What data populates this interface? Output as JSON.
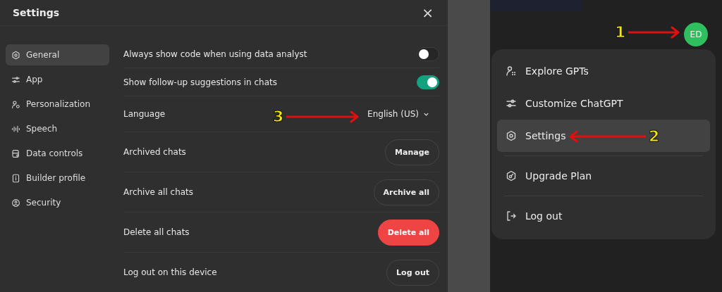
{
  "settings_dialog": {
    "title": "Settings",
    "close": "×",
    "sidebar": {
      "items": [
        {
          "label": "General",
          "selected": true
        },
        {
          "label": "App",
          "selected": false
        },
        {
          "label": "Personalization",
          "selected": false
        },
        {
          "label": "Speech",
          "selected": false
        },
        {
          "label": "Data controls",
          "selected": false
        },
        {
          "label": "Builder profile",
          "selected": false
        },
        {
          "label": "Security",
          "selected": false
        }
      ]
    },
    "rows": [
      {
        "kind": "toggle",
        "label": "Always show code when using data analyst",
        "on": false
      },
      {
        "kind": "toggle",
        "label": "Show follow-up suggestions in chats",
        "on": true
      },
      {
        "kind": "select",
        "label": "Language",
        "value": "English (US)"
      },
      {
        "kind": "button",
        "label": "Archived chats",
        "button": "Manage"
      },
      {
        "kind": "button",
        "label": "Archive all chats",
        "button": "Archive all"
      },
      {
        "kind": "danger",
        "label": "Delete all chats",
        "button": "Delete all"
      },
      {
        "kind": "button",
        "label": "Log out on this device",
        "button": "Log out"
      }
    ]
  },
  "avatar": {
    "initials": "ED"
  },
  "account_menu": {
    "items": [
      {
        "label": "Explore GPTs",
        "selected": false
      },
      {
        "label": "Customize ChatGPT",
        "selected": false
      },
      {
        "label": "Settings",
        "selected": true
      },
      {
        "label": "Upgrade Plan",
        "selected": false
      },
      {
        "label": "Log out",
        "selected": false
      }
    ]
  },
  "annotations": [
    {
      "label": "1"
    },
    {
      "label": "2"
    },
    {
      "label": "3"
    }
  ]
}
